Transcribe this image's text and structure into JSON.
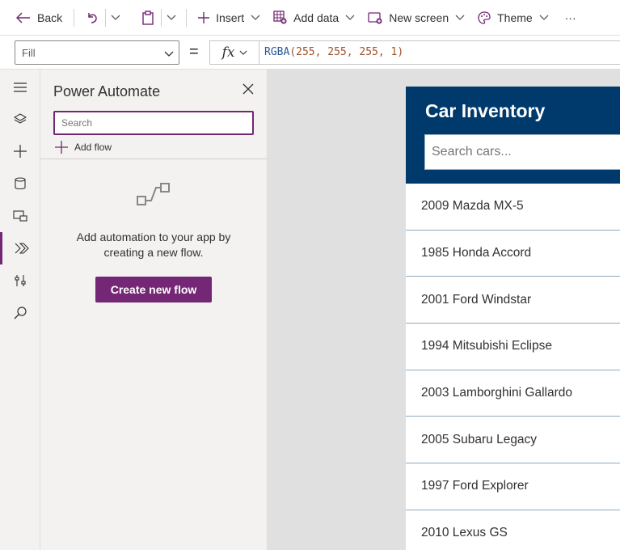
{
  "toolbar": {
    "back_label": "Back",
    "insert_label": "Insert",
    "add_data_label": "Add data",
    "new_screen_label": "New screen",
    "theme_label": "Theme",
    "more_label": "···"
  },
  "formula_bar": {
    "property": "Fill",
    "fx_label": "fx",
    "formula_fn": "RGBA",
    "formula_args": "(255, 255, 255, 1)"
  },
  "panel": {
    "title": "Power Automate",
    "search_placeholder": "Search",
    "add_flow_label": "Add flow",
    "empty_text": "Add automation to your app by creating a new flow.",
    "create_button_label": "Create new flow"
  },
  "app": {
    "title": "Car Inventory",
    "search_placeholder": "Search cars...",
    "cars": [
      "2009 Mazda MX-5",
      "1985 Honda Accord",
      "2001 Ford Windstar",
      "1994 Mitsubishi Eclipse",
      "2003 Lamborghini Gallardo",
      "2005 Subaru Legacy",
      "1997 Ford Explorer",
      "2010 Lexus GS"
    ]
  },
  "colors": {
    "accent": "#742774",
    "app_header": "#003a6c"
  }
}
